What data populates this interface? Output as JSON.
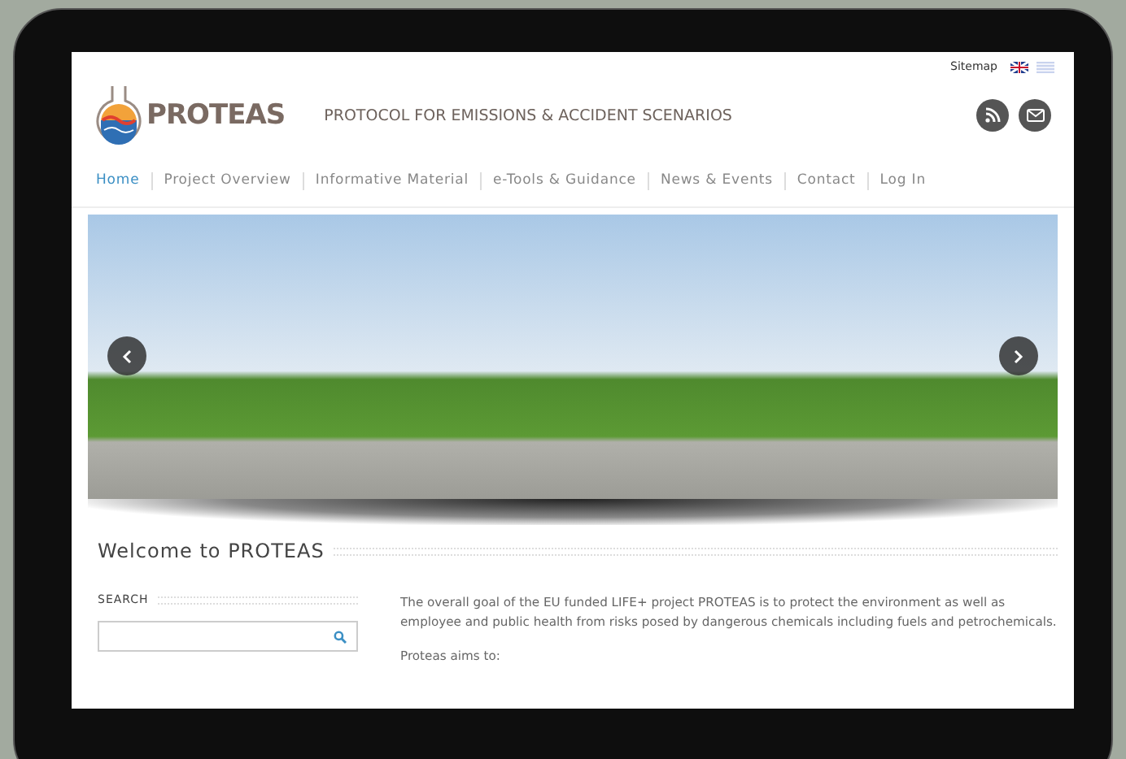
{
  "top_bar": {
    "sitemap": "Sitemap"
  },
  "header": {
    "logo": "PROTEAS",
    "tagline": "PROTOCOL FOR EMISSIONS & ACCIDENT SCENARIOS"
  },
  "nav": [
    {
      "label": "Home",
      "selected": true
    },
    {
      "label": "Project Overview",
      "selected": false
    },
    {
      "label": "Informative Material",
      "selected": false
    },
    {
      "label": "e-Tools & Guidance",
      "selected": false
    },
    {
      "label": "News & Events",
      "selected": false
    },
    {
      "label": "Contact",
      "selected": false
    },
    {
      "label": "Log In",
      "selected": false
    }
  ],
  "welcome": {
    "title": "Welcome to PROTEAS"
  },
  "sidebar": {
    "heading": "SEARCH"
  },
  "content": {
    "paragraphs": [
      "The overall goal of the EU funded LIFE+ project PROTEAS is to protect the environment as well as employee and public health from risks posed by dangerous chemicals including fuels and petrochemicals.",
      "Proteas aims to:"
    ]
  }
}
